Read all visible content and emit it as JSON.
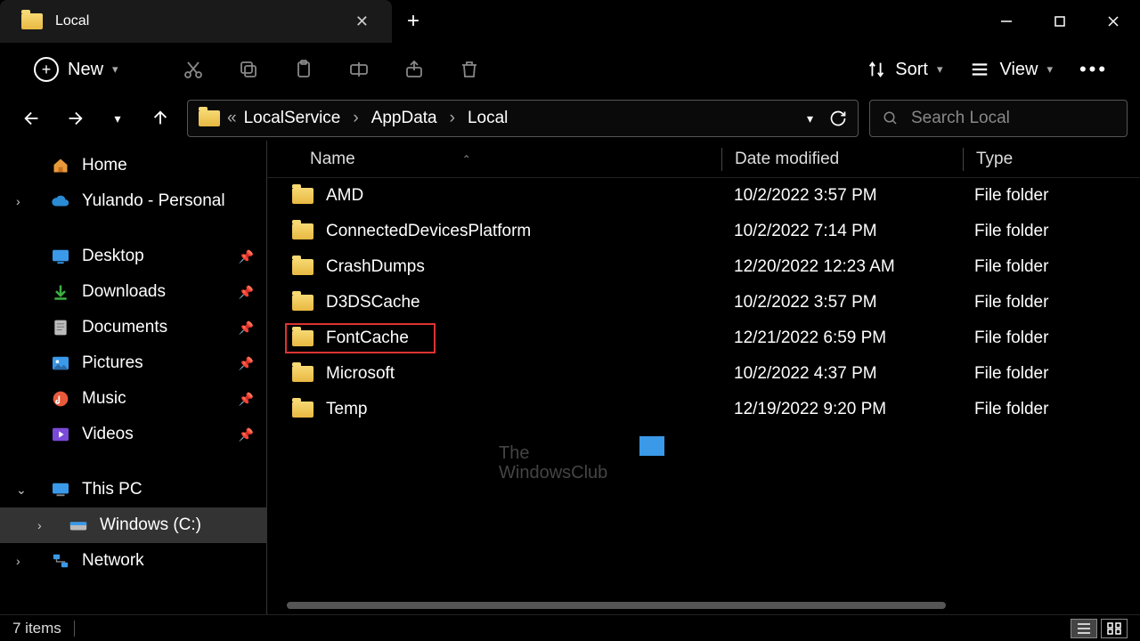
{
  "tab": {
    "title": "Local"
  },
  "toolbar": {
    "new_label": "New",
    "sort_label": "Sort",
    "view_label": "View"
  },
  "breadcrumb": {
    "prefix": "«",
    "items": [
      "LocalService",
      "AppData",
      "Local"
    ]
  },
  "search": {
    "placeholder": "Search Local"
  },
  "sidebar": {
    "home": "Home",
    "personal": "Yulando - Personal",
    "desktop": "Desktop",
    "downloads": "Downloads",
    "documents": "Documents",
    "pictures": "Pictures",
    "music": "Music",
    "videos": "Videos",
    "this_pc": "This PC",
    "drive": "Windows (C:)",
    "network": "Network"
  },
  "columns": {
    "name": "Name",
    "date": "Date modified",
    "type": "Type"
  },
  "rows": [
    {
      "name": "AMD",
      "date": "10/2/2022 3:57 PM",
      "type": "File folder",
      "highlight": false
    },
    {
      "name": "ConnectedDevicesPlatform",
      "date": "10/2/2022 7:14 PM",
      "type": "File folder",
      "highlight": false
    },
    {
      "name": "CrashDumps",
      "date": "12/20/2022 12:23 AM",
      "type": "File folder",
      "highlight": false
    },
    {
      "name": "D3DSCache",
      "date": "10/2/2022 3:57 PM",
      "type": "File folder",
      "highlight": false
    },
    {
      "name": "FontCache",
      "date": "12/21/2022 6:59 PM",
      "type": "File folder",
      "highlight": true
    },
    {
      "name": "Microsoft",
      "date": "10/2/2022 4:37 PM",
      "type": "File folder",
      "highlight": false
    },
    {
      "name": "Temp",
      "date": "12/19/2022 9:20 PM",
      "type": "File folder",
      "highlight": false
    }
  ],
  "status": {
    "count": "7 items"
  },
  "watermark": {
    "line1": "The",
    "line2": "WindowsClub"
  }
}
